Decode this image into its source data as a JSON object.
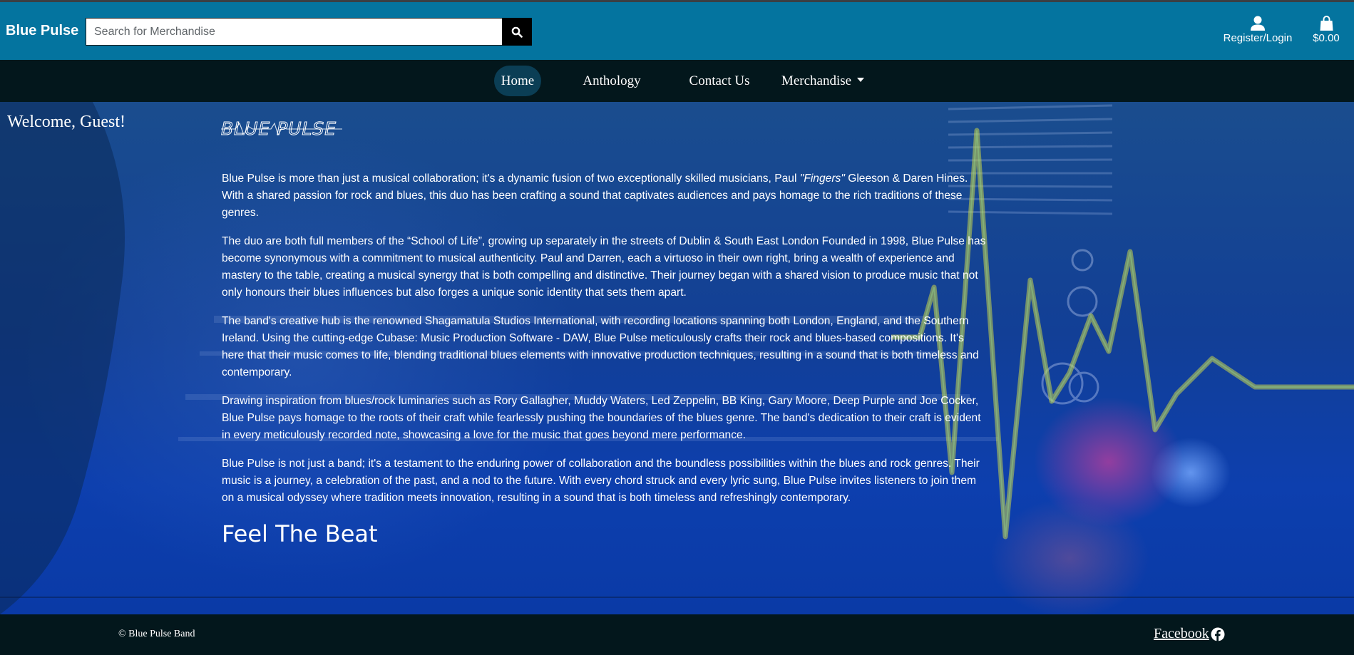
{
  "header": {
    "brand": "Blue Pulse",
    "search": {
      "placeholder": "Search for Merchandise",
      "value": "",
      "button_icon": "search-icon"
    },
    "account": {
      "label": "Register/Login",
      "icon": "user-icon"
    },
    "bag": {
      "label": "$0.00",
      "icon": "shopping-bag-icon"
    }
  },
  "nav": {
    "items": [
      {
        "label": "Home",
        "active": true
      },
      {
        "label": "Anthology"
      },
      {
        "label": "Contact Us"
      },
      {
        "label": "Merchandise",
        "dropdown": true
      }
    ]
  },
  "main": {
    "welcome": "Welcome, Guest!",
    "logo_text": "BLUE PULSE",
    "paragraphs": [
      {
        "before": "Blue Pulse is more than just a musical collaboration; it's a dynamic fusion of two exceptionally skilled musicians, Paul ",
        "emph": "\"Fingers\"",
        "after": " Gleeson & Daren Hines. With a shared passion for rock and blues, this duo has been crafting a sound that captivates audiences and pays homage to the rich traditions of these genres."
      },
      "The duo are both full members of the “School of Life”, growing up separately in the streets of Dublin & South East London Founded in 1998, Blue Pulse has become synonymous with a commitment to musical authenticity. Paul and Darren, each a virtuoso in their own right, bring a wealth of experience and mastery to the table, creating a musical synergy that is both compelling and distinctive. Their journey began with a shared vision to produce music that not only honours their blues influences but also forges a unique sonic identity that sets them apart.",
      "The band's creative hub is the renowned Shagamatula Studios International, with recording locations spanning both London, England, and the Southern Ireland. Using the cutting-edge Cubase: Music Production Software - DAW, Blue Pulse meticulously crafts their rock and blues-based compositions. It's here that their music comes to life, blending traditional blues elements with innovative production techniques, resulting in a sound that is both timeless and contemporary.",
      "Drawing inspiration from blues/rock luminaries such as Rory Gallagher, Muddy Waters, Led Zeppelin, BB King, Gary Moore, Deep Purple and Joe Cocker, Blue Pulse pays homage to the roots of their craft while fearlessly pushing the boundaries of the blues genre. The band's dedication to their craft is evident in every meticulously recorded note, showcasing a love for the music that goes beyond mere performance.",
      "Blue Pulse is not just a band; it's a testament to the enduring power of collaboration and the boundless possibilities within the blues and rock genres. Their music is a journey, a celebration of the past, and a nod to the future. With every chord struck and every lyric sung, Blue Pulse invites listeners to join them on a musical odyssey where tradition meets innovation, resulting in a sound that is both timeless and refreshingly contemporary."
    ],
    "tagline": "Feel The Beat"
  },
  "footer": {
    "copyright": "© Blue Pulse Band",
    "facebook_label": "Facebook",
    "facebook_icon": "facebook-icon"
  },
  "colors": {
    "header_bg": "#04749f",
    "nav_bg": "#03171c",
    "footer_bg": "#03171c",
    "hero_bg": "#0d3fae",
    "active_pill": "#0b3e55"
  }
}
